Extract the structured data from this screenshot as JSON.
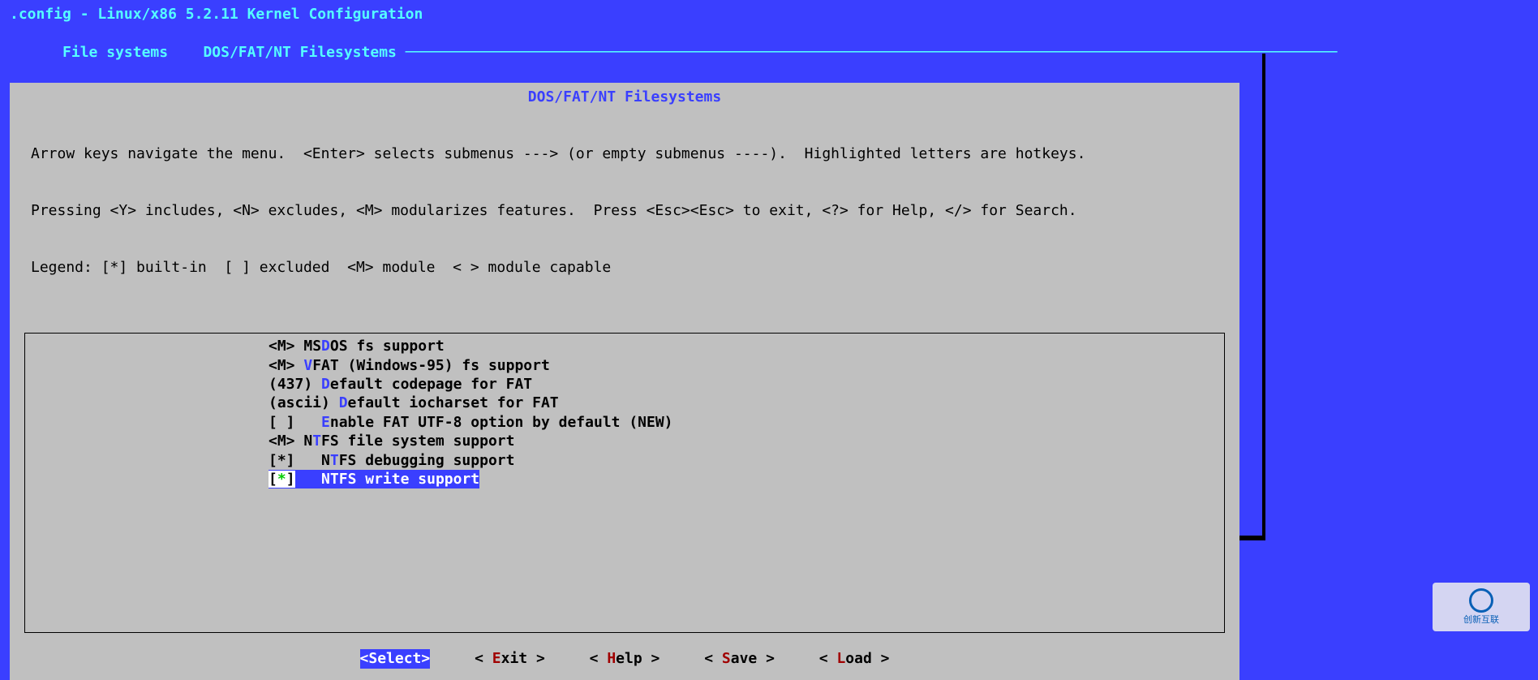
{
  "title": ".config - Linux/x86 5.2.11 Kernel Configuration",
  "breadcrumb": [
    "File systems",
    "DOS/FAT/NT Filesystems"
  ],
  "panel_title": "DOS/FAT/NT Filesystems",
  "help_lines": [
    "Arrow keys navigate the menu.  <Enter> selects submenus ---> (or empty submenus ----).  Highlighted letters are hotkeys.",
    "Pressing <Y> includes, <N> excludes, <M> modularizes features.  Press <Esc><Esc> to exit, <?> for Help, </> for Search.",
    "Legend: [*] built-in  [ ] excluded  <M> module  < > module capable"
  ],
  "menu": [
    {
      "prefix": "<M> ",
      "pre": "MS",
      "hotkey": "D",
      "post": "OS fs support",
      "selected": false
    },
    {
      "prefix": "<M> ",
      "pre": "",
      "hotkey": "V",
      "post": "FAT (Windows-95) fs support",
      "selected": false
    },
    {
      "prefix": "(437) ",
      "pre": "",
      "hotkey": "D",
      "post": "efault codepage for FAT",
      "selected": false
    },
    {
      "prefix": "(ascii) ",
      "pre": "",
      "hotkey": "D",
      "post": "efault iocharset for FAT",
      "selected": false
    },
    {
      "prefix": "[ ]   ",
      "pre": "",
      "hotkey": "E",
      "post": "nable FAT UTF-8 option by default (NEW)",
      "selected": false
    },
    {
      "prefix": "<M> ",
      "pre": "N",
      "hotkey": "T",
      "post": "FS file system support",
      "selected": false
    },
    {
      "prefix": "[*]   ",
      "pre": "N",
      "hotkey": "T",
      "post": "FS debugging support",
      "selected": false
    },
    {
      "prefix_sel": "[*]   ",
      "pre": "N",
      "hotkey": "T",
      "post": "FS write support",
      "selected": true
    }
  ],
  "buttons": [
    {
      "pre": "<",
      "hk": "S",
      "post": "elect>",
      "selected": true
    },
    {
      "pre": "< ",
      "hk": "E",
      "post": "xit >",
      "selected": false
    },
    {
      "pre": "< ",
      "hk": "H",
      "post": "elp >",
      "selected": false
    },
    {
      "pre": "< ",
      "hk": "S",
      "post": "ave >",
      "selected": false
    },
    {
      "pre": "< ",
      "hk": "L",
      "post": "oad >",
      "selected": false
    }
  ],
  "watermark": "创新互联"
}
